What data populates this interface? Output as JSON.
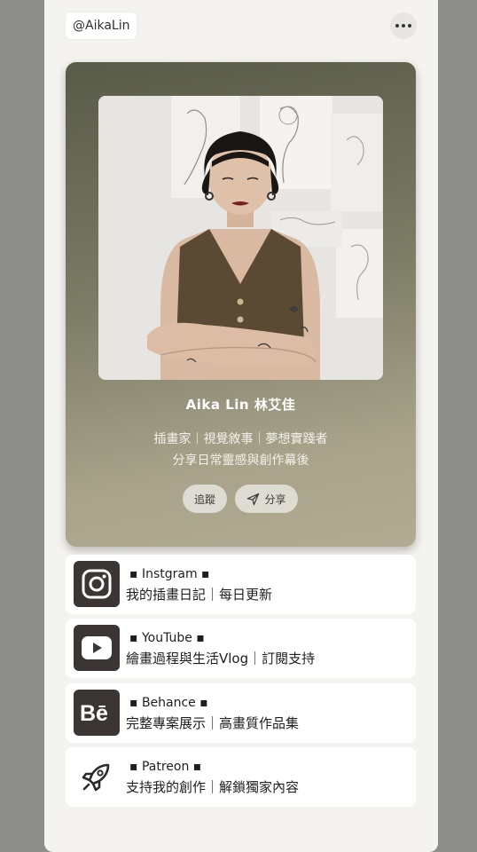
{
  "header": {
    "handle": "@AikaLin"
  },
  "profile": {
    "name": "Aika Lin 林艾佳",
    "bio_line1": "插畫家｜視覺敘事｜夢想實踐者",
    "bio_line2": "分享日常靈感與創作幕後",
    "follow_label": "追蹤",
    "share_label": "分享"
  },
  "links": [
    {
      "title": "▪ Instgram ▪",
      "desc": "我的插畫日記｜每日更新",
      "icon": "instagram-icon"
    },
    {
      "title": "▪ YouTube ▪",
      "desc": "繪畫過程與生活Vlog｜訂閱支持",
      "icon": "youtube-icon"
    },
    {
      "title": "▪ Behance ▪",
      "desc": "完整專案展示｜高畫質作品集",
      "icon": "behance-icon"
    },
    {
      "title": "▪ Patreon ▪",
      "desc": "支持我的創作｜解鎖獨家內容",
      "icon": "rocket-icon"
    }
  ],
  "colors": {
    "card_dark": "#585b48",
    "card_light": "#b2ab92",
    "icon_bg": "#3b3633",
    "page_bg": "#f4f3f0"
  }
}
